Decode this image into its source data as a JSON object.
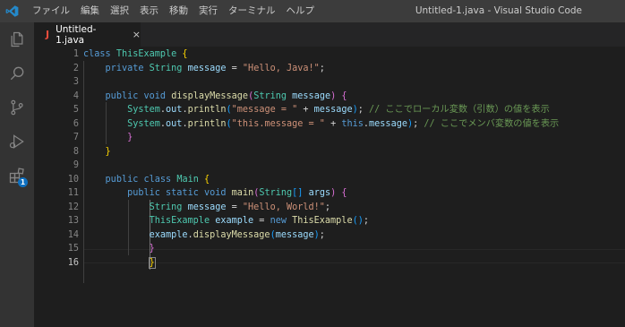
{
  "titlebar": {
    "menu": [
      "ファイル",
      "編集",
      "選択",
      "表示",
      "移動",
      "実行",
      "ターミナル",
      "ヘルプ"
    ],
    "window_title": "Untitled-1.java - Visual Studio Code"
  },
  "activity_bar": {
    "icons": [
      "explorer-icon",
      "search-icon",
      "source-control-icon",
      "run-debug-icon",
      "extensions-icon"
    ],
    "extensions_badge": "1"
  },
  "tab": {
    "icon": "J",
    "label": "Untitled-1.java",
    "close": "×"
  },
  "editor": {
    "line_numbers": [
      "1",
      "2",
      "3",
      "4",
      "5",
      "6",
      "7",
      "8",
      "9",
      "10",
      "11",
      "12",
      "13",
      "14",
      "15",
      "16"
    ],
    "active_line": 16,
    "lines": [
      [
        [
          "kw",
          "class"
        ],
        [
          "pl",
          " "
        ],
        [
          "ty",
          "ThisExample"
        ],
        [
          "pl",
          " "
        ],
        [
          "b1",
          "{"
        ]
      ],
      [
        [
          "pl",
          "    "
        ],
        [
          "kw",
          "private"
        ],
        [
          "pl",
          " "
        ],
        [
          "ty",
          "String"
        ],
        [
          "pl",
          " "
        ],
        [
          "vr",
          "message"
        ],
        [
          "pl",
          " = "
        ],
        [
          "st",
          "\"Hello, Java!\""
        ],
        [
          "pl",
          ";"
        ]
      ],
      [],
      [
        [
          "pl",
          "    "
        ],
        [
          "kw",
          "public"
        ],
        [
          "pl",
          " "
        ],
        [
          "kw",
          "void"
        ],
        [
          "pl",
          " "
        ],
        [
          "fn",
          "displayMessage"
        ],
        [
          "b2",
          "("
        ],
        [
          "ty",
          "String"
        ],
        [
          "pl",
          " "
        ],
        [
          "vr",
          "message"
        ],
        [
          "b2",
          ")"
        ],
        [
          "pl",
          " "
        ],
        [
          "b2",
          "{"
        ]
      ],
      [
        [
          "pl",
          "        "
        ],
        [
          "ty",
          "System"
        ],
        [
          "pl",
          "."
        ],
        [
          "vr",
          "out"
        ],
        [
          "pl",
          "."
        ],
        [
          "fn",
          "println"
        ],
        [
          "b3",
          "("
        ],
        [
          "st",
          "\"message = \""
        ],
        [
          "pl",
          " + "
        ],
        [
          "vr",
          "message"
        ],
        [
          "b3",
          ")"
        ],
        [
          "pl",
          "; "
        ],
        [
          "cm",
          "// ここでローカル変数（引数）の値を表示"
        ]
      ],
      [
        [
          "pl",
          "        "
        ],
        [
          "ty",
          "System"
        ],
        [
          "pl",
          "."
        ],
        [
          "vr",
          "out"
        ],
        [
          "pl",
          "."
        ],
        [
          "fn",
          "println"
        ],
        [
          "b3",
          "("
        ],
        [
          "st",
          "\"this.message = \""
        ],
        [
          "pl",
          " + "
        ],
        [
          "kw",
          "this"
        ],
        [
          "pl",
          "."
        ],
        [
          "vr",
          "message"
        ],
        [
          "b3",
          ")"
        ],
        [
          "pl",
          "; "
        ],
        [
          "cm",
          "// ここでメンバ変数の値を表示"
        ]
      ],
      [
        [
          "pl",
          "        "
        ],
        [
          "b2",
          "}"
        ]
      ],
      [
        [
          "pl",
          "    "
        ],
        [
          "b1",
          "}"
        ]
      ],
      [],
      [
        [
          "pl",
          "    "
        ],
        [
          "kw",
          "public"
        ],
        [
          "pl",
          " "
        ],
        [
          "kw",
          "class"
        ],
        [
          "pl",
          " "
        ],
        [
          "ty",
          "Main"
        ],
        [
          "pl",
          " "
        ],
        [
          "b1",
          "{"
        ]
      ],
      [
        [
          "pl",
          "        "
        ],
        [
          "kw",
          "public"
        ],
        [
          "pl",
          " "
        ],
        [
          "kw",
          "static"
        ],
        [
          "pl",
          " "
        ],
        [
          "kw",
          "void"
        ],
        [
          "pl",
          " "
        ],
        [
          "fn",
          "main"
        ],
        [
          "b2",
          "("
        ],
        [
          "ty",
          "String"
        ],
        [
          "b3",
          "[]"
        ],
        [
          "pl",
          " "
        ],
        [
          "vr",
          "args"
        ],
        [
          "b2",
          ")"
        ],
        [
          "pl",
          " "
        ],
        [
          "b2",
          "{"
        ]
      ],
      [
        [
          "pl",
          "            "
        ],
        [
          "ty",
          "String"
        ],
        [
          "pl",
          " "
        ],
        [
          "vr",
          "message"
        ],
        [
          "pl",
          " = "
        ],
        [
          "st",
          "\"Hello, World!\""
        ],
        [
          "pl",
          ";"
        ]
      ],
      [
        [
          "pl",
          "            "
        ],
        [
          "ty",
          "ThisExample"
        ],
        [
          "pl",
          " "
        ],
        [
          "vr",
          "example"
        ],
        [
          "pl",
          " = "
        ],
        [
          "kw",
          "new"
        ],
        [
          "pl",
          " "
        ],
        [
          "fn",
          "ThisExample"
        ],
        [
          "b3",
          "()"
        ],
        [
          "pl",
          ";"
        ]
      ],
      [
        [
          "pl",
          "            "
        ],
        [
          "vr",
          "example"
        ],
        [
          "pl",
          "."
        ],
        [
          "fn",
          "displayMessage"
        ],
        [
          "b3",
          "("
        ],
        [
          "vr",
          "message"
        ],
        [
          "b3",
          ")"
        ],
        [
          "pl",
          ";"
        ]
      ],
      [
        [
          "pl",
          "            "
        ],
        [
          "b2",
          "}"
        ]
      ],
      [
        [
          "pl",
          "            "
        ],
        [
          "b1",
          "}"
        ]
      ]
    ]
  },
  "colors": {
    "keyword": "#569cd6",
    "type": "#4ec9b0",
    "variable": "#9cdcfe",
    "string": "#ce9178",
    "function": "#dcdcaa",
    "comment": "#6a9955",
    "bracket_1": "#ffd700",
    "bracket_2": "#da70d6",
    "bracket_3": "#179fff"
  }
}
